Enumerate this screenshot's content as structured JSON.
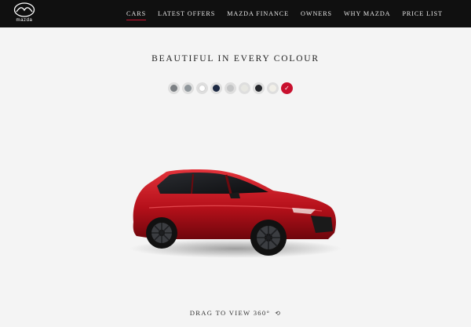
{
  "brand": {
    "wordmark": "mazda"
  },
  "nav": {
    "items": [
      {
        "label": "CARS",
        "active": true
      },
      {
        "label": "LATEST OFFERS"
      },
      {
        "label": "MAZDA FINANCE"
      },
      {
        "label": "OWNERS"
      },
      {
        "label": "WHY MAZDA"
      },
      {
        "label": "PRICE LIST"
      }
    ]
  },
  "heading": "BEAUTIFUL IN EVERY COLOUR",
  "swatches": [
    {
      "color": "#7c8084"
    },
    {
      "color": "#8f969b"
    },
    {
      "color": "#ffffff"
    },
    {
      "color": "#1d2a44"
    },
    {
      "color": "#c3c4c5"
    },
    {
      "color": "#e7e7e2"
    },
    {
      "color": "#24262b"
    },
    {
      "color": "#f1efe8"
    },
    {
      "color": "#c8102e",
      "selected": true
    }
  ],
  "car": {
    "color": "#c4141f",
    "icon": "red-hatchback-car"
  },
  "drag": {
    "label": "DRAG TO VIEW 360°",
    "icon": "rotate-360-icon"
  }
}
